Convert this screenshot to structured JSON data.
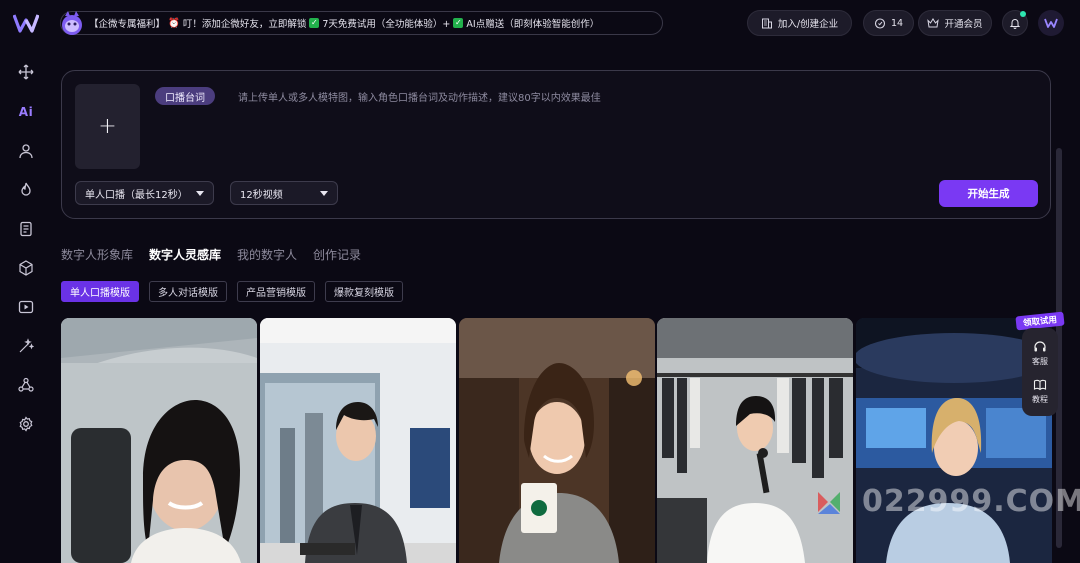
{
  "promo": {
    "text1": "【企微专属福利】",
    "text2": "叮！添加企微好友，立即解锁",
    "text3": "7天免费试用（全功能体验）+",
    "text4": "AI点赠送（即刻体验智能创作）"
  },
  "topbar": {
    "enterprise_label": "加入/创建企业",
    "points_value": "14",
    "vip_label": "开通会员"
  },
  "rail": {
    "ai_label": "Ai"
  },
  "composer": {
    "tag_label": "口播台词",
    "hint": "请上传单人或多人模特图，输入角色口播台词及动作描述，建议80字以内效果最佳",
    "upload_symbol": "+",
    "mode_value": "单人口播（最长12秒）",
    "duration_value": "12秒视频",
    "generate_label": "开始生成"
  },
  "tabs": [
    {
      "label": "数字人形象库"
    },
    {
      "label": "数字人灵感库"
    },
    {
      "label": "我的数字人"
    },
    {
      "label": "创作记录"
    }
  ],
  "chips": [
    {
      "label": "单人口播模版"
    },
    {
      "label": "多人对话模版"
    },
    {
      "label": "产品营销模版"
    },
    {
      "label": "爆款复刻模版"
    }
  ],
  "side": {
    "trial_label": "领取试用",
    "service_label": "客服",
    "tutorial_label": "教程"
  },
  "watermark": "022999.COM",
  "colors": {
    "accent": "#7a39f3",
    "background": "#0b0914"
  }
}
